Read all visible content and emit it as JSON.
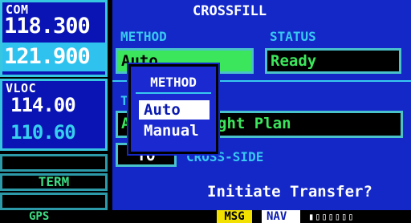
{
  "left": {
    "com": {
      "label": "COM",
      "active": "118.300",
      "standby": "121.900"
    },
    "vloc": {
      "label": "VLOC",
      "active": "114.00",
      "standby": "110.60"
    },
    "slots": [
      "",
      "TERM",
      ""
    ]
  },
  "main": {
    "title": "CROSSFILL",
    "method_label": "METHOD",
    "status_label": "STATUS",
    "method_value": "Auto",
    "status_value": "Ready",
    "item_label": "T",
    "item_value_prefix": "A",
    "item_value_suffix": "ght Plan",
    "direction_value": "TO",
    "cross_side_label": "CROSS-SIDE",
    "prompt": "Initiate Transfer?"
  },
  "popup": {
    "title": "METHOD",
    "options": [
      "Auto",
      "Manual"
    ],
    "selected_index": 0
  },
  "status_bar": {
    "gps": "GPS",
    "msg": "MSG",
    "nav": "NAV",
    "signal_boxes": "▮▯▯▯▯▯▯"
  },
  "colors": {
    "panel_blue": "#1428c8",
    "accent_cyan": "#38c8f0",
    "field_green": "#3ce65c",
    "msg_yellow": "#f2e000"
  }
}
